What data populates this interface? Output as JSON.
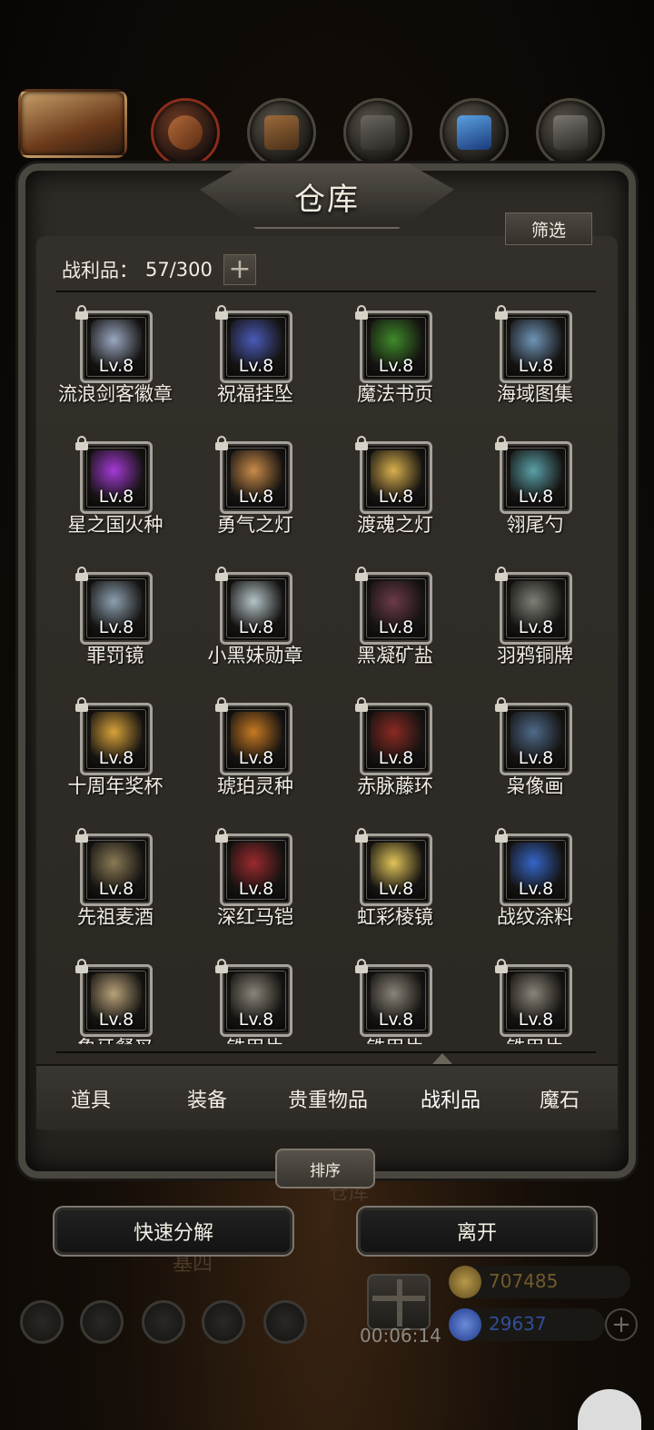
{
  "window": {
    "title": "仓库"
  },
  "toolbar": {
    "filter_label": "筛选",
    "sort_label": "排序"
  },
  "inventory": {
    "category_label": "战利品：",
    "count": "57/300",
    "expand_symbol": "+"
  },
  "items": [
    {
      "name": "流浪剑客徽章",
      "level": "Lv.8",
      "color": "#9aa7c0"
    },
    {
      "name": "祝福挂坠",
      "level": "Lv.8",
      "color": "#4a5bb8"
    },
    {
      "name": "魔法书页",
      "level": "Lv.8",
      "color": "#3f8a2a"
    },
    {
      "name": "海域图集",
      "level": "Lv.8",
      "color": "#6f95b8"
    },
    {
      "name": "星之国火种",
      "level": "Lv.8",
      "color": "#a43ad6"
    },
    {
      "name": "勇气之灯",
      "level": "Lv.8",
      "color": "#c98b4a"
    },
    {
      "name": "渡魂之灯",
      "level": "Lv.8",
      "color": "#d9b04e"
    },
    {
      "name": "翎尾勺",
      "level": "Lv.8",
      "color": "#5aa0a8"
    },
    {
      "name": "罪罚镜",
      "level": "Lv.8",
      "color": "#8da0b0"
    },
    {
      "name": "小黑妹勋章",
      "level": "Lv.8",
      "color": "#b5c4c8"
    },
    {
      "name": "黑凝矿盐",
      "level": "Lv.8",
      "color": "#6b3b48"
    },
    {
      "name": "羽鸦铜牌",
      "level": "Lv.8",
      "color": "#7d8077"
    },
    {
      "name": "十周年奖杯",
      "level": "Lv.8",
      "color": "#d8a23a"
    },
    {
      "name": "琥珀灵种",
      "level": "Lv.8",
      "color": "#c77a22"
    },
    {
      "name": "赤脉藤环",
      "level": "Lv.8",
      "color": "#8a2a22"
    },
    {
      "name": "枭像画",
      "level": "Lv.8",
      "color": "#4f6a8a"
    },
    {
      "name": "先祖麦酒",
      "level": "Lv.8",
      "color": "#8a7a55"
    },
    {
      "name": "深红马铠",
      "level": "Lv.8",
      "color": "#9a2a2e"
    },
    {
      "name": "虹彩棱镜",
      "level": "Lv.8",
      "color": "#e0c45a"
    },
    {
      "name": "战纹涂料",
      "level": "Lv.8",
      "color": "#3566c8"
    },
    {
      "name": "象牙餐叉",
      "level": "Lv.8",
      "color": "#b8a27a"
    },
    {
      "name": "铁甲片",
      "level": "Lv.8",
      "color": "#8a8478"
    },
    {
      "name": "铁甲片",
      "level": "Lv.8",
      "color": "#8a8478"
    },
    {
      "name": "铁甲片",
      "level": "Lv.8",
      "color": "#8a8478"
    }
  ],
  "tabs": [
    {
      "label": "道具"
    },
    {
      "label": "装备"
    },
    {
      "label": "贵重物品"
    },
    {
      "label": "战利品"
    },
    {
      "label": "魔石"
    }
  ],
  "actions": {
    "quick_decompose": "快速分解",
    "leave": "离开"
  },
  "hud": {
    "timer": "00:06:14",
    "gold": "707485",
    "gems": "29637",
    "behind_text_1": "仓库",
    "behind_text_2": "基四"
  },
  "colors": {
    "frame": "#4a4640",
    "panel": "#2e2b26",
    "gold": "#6b5a2a",
    "gem": "#1f3a8a"
  }
}
